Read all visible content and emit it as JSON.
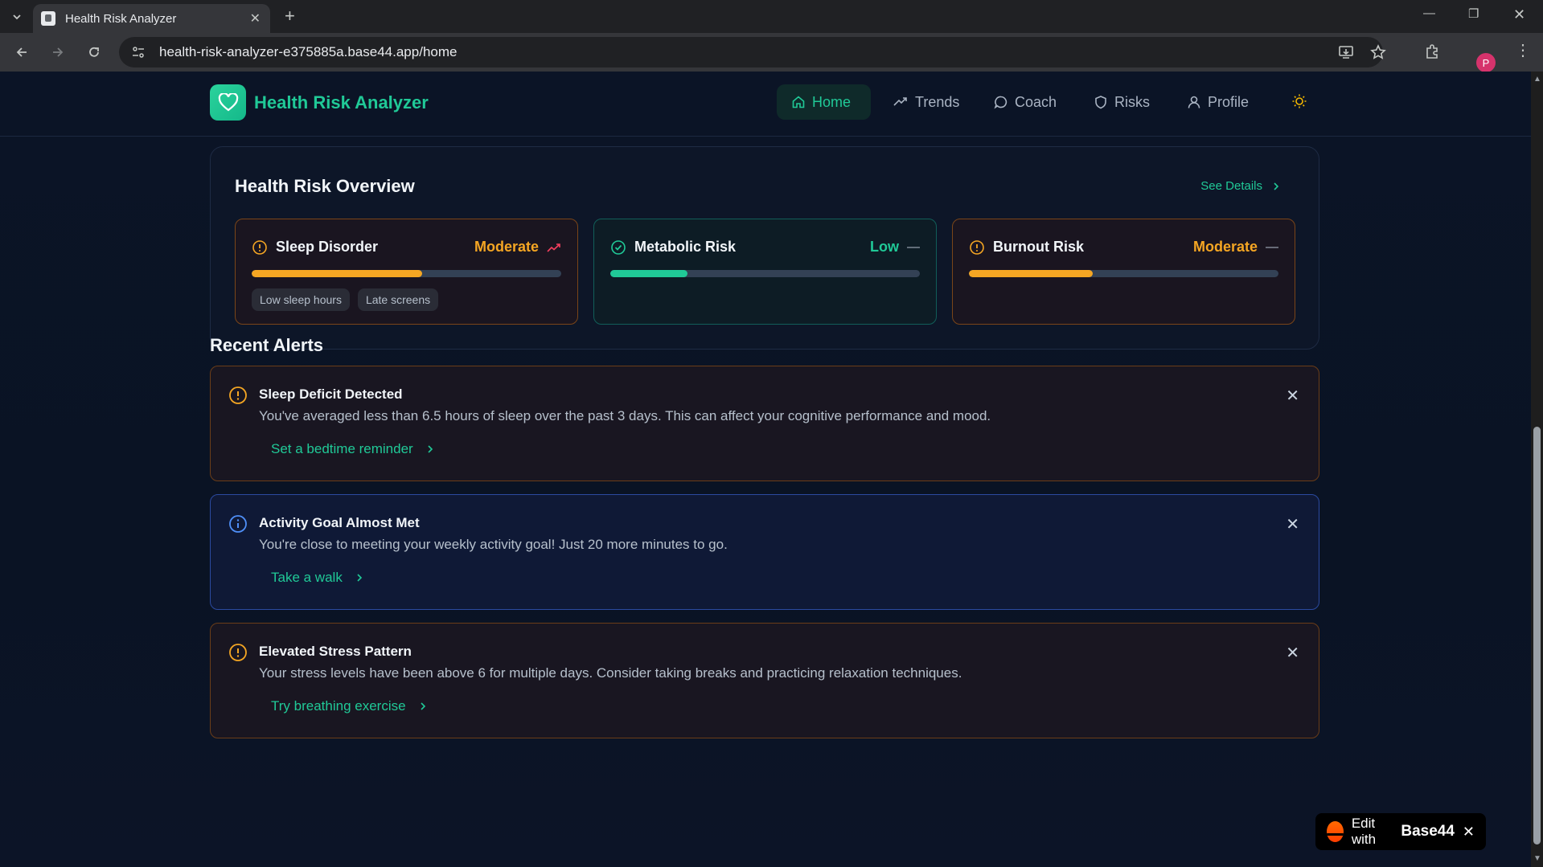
{
  "browser": {
    "tab_title": "Health Risk Analyzer",
    "url": "health-risk-analyzer-e375885a.base44.app/home",
    "profile_initial": "P"
  },
  "app": {
    "brand": "Health Risk Analyzer",
    "nav": [
      {
        "label": "Home",
        "icon": "home-icon",
        "active": true
      },
      {
        "label": "Trends",
        "icon": "trend-icon",
        "active": false
      },
      {
        "label": "Coach",
        "icon": "chat-icon",
        "active": false
      },
      {
        "label": "Risks",
        "icon": "shield-icon",
        "active": false
      },
      {
        "label": "Profile",
        "icon": "user-icon",
        "active": false
      }
    ]
  },
  "overview": {
    "title": "Health Risk Overview",
    "see_details": "See Details",
    "risks": [
      {
        "name": "Sleep Disorder",
        "level": "Moderate",
        "level_color": "#f5a623",
        "progress": 0.55,
        "bar_color": "#f5a623",
        "trend": "trending-up-icon",
        "tags": [
          "Low sleep hours",
          "Late screens"
        ]
      },
      {
        "name": "Metabolic Risk",
        "level": "Low",
        "level_color": "#20c997",
        "progress": 0.25,
        "bar_color": "#20c997",
        "trend": "minus-icon",
        "tags": []
      },
      {
        "name": "Burnout Risk",
        "level": "Moderate",
        "level_color": "#f5a623",
        "progress": 0.4,
        "bar_color": "#f5a623",
        "trend": "minus-icon",
        "tags": []
      }
    ]
  },
  "alerts": {
    "title": "Recent Alerts",
    "items": [
      {
        "type": "warning",
        "title": "Sleep Deficit Detected",
        "description": "You've averaged less than 6.5 hours of sleep over the past 3 days. This can affect your cognitive performance and mood.",
        "action": "Set a bedtime reminder"
      },
      {
        "type": "info",
        "title": "Activity Goal Almost Met",
        "description": "You're close to meeting your weekly activity goal! Just 20 more minutes to go.",
        "action": "Take a walk"
      },
      {
        "type": "warning",
        "title": "Elevated Stress Pattern",
        "description": "Your stress levels have been above 6 for multiple days. Consider taking breaks and practicing relaxation techniques.",
        "action": "Try breathing exercise"
      }
    ]
  },
  "badge": {
    "text": "Edit with",
    "brand": "Base44"
  }
}
